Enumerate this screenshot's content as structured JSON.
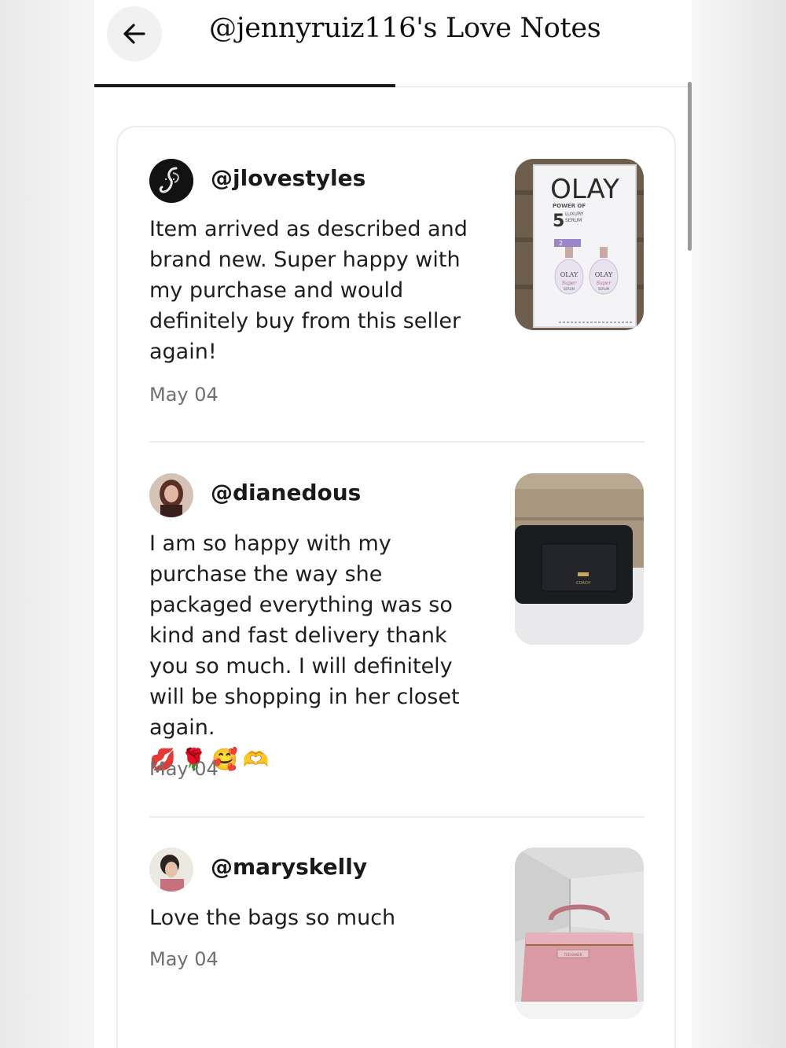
{
  "header": {
    "title": "@jennyruiz116's Love Notes",
    "back_icon": "arrow-left-icon"
  },
  "notes": [
    {
      "username": "@jlovestyles",
      "review": "Item arrived as described and brand new. Super happy with my purchase and would definitely buy from this seller again!",
      "date": "May 04",
      "product": {
        "brand": "OLAY",
        "line1": "POWER OF",
        "number": "5",
        "line2": "LUXURY",
        "line3": "SERUM",
        "badge": "2",
        "bottle_label": "OLAY",
        "bottle_sub": "Super",
        "bottle_sub2": "SERUM"
      }
    },
    {
      "username": "@dianedous",
      "review": "I am so happy with my purchase the way she packaged everything was so kind and fast delivery thank you so much. I will definitely will be shopping in her closet again.",
      "emojis": [
        "💋",
        "🌹",
        "🥰",
        "🫶"
      ],
      "date": "May 04",
      "product": {
        "logo": "COACH"
      }
    },
    {
      "username": "@maryskelly",
      "review": "Love the bags so much",
      "date": "May 04",
      "product": {
        "logo": "TED BAKER"
      }
    }
  ],
  "colors": {
    "text": "#1e1e1e",
    "muted": "#707070",
    "divider": "#ececec",
    "tab_active": "#1a1a1a"
  }
}
